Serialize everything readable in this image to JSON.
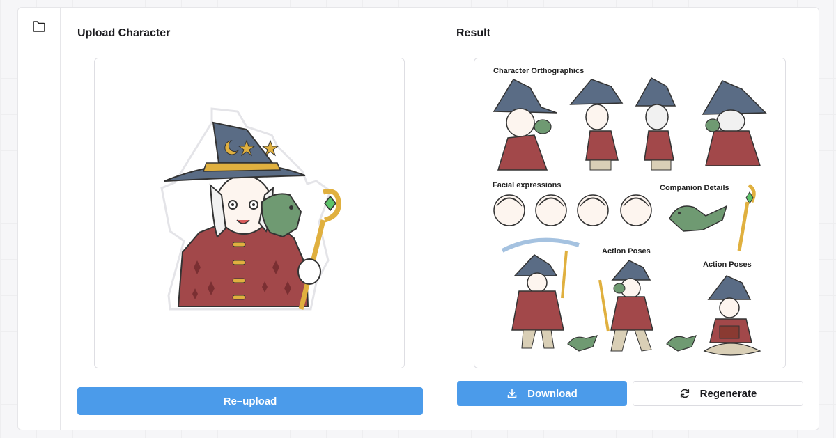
{
  "left_panel": {
    "title": "Upload Character",
    "reupload_label": "Re–upload"
  },
  "right_panel": {
    "title": "Result",
    "download_label": "Download",
    "regenerate_label": "Regenerate"
  },
  "sheet": {
    "orthographics_label": "Character Orthographics",
    "facial_label": "Facial expressions",
    "companion_label": "Companion Details",
    "action_label_1": "Action Poses",
    "action_label_2": "Action Poses"
  },
  "colors": {
    "accent": "#4b9bea",
    "hat": "#5a6c85",
    "cloak": "#a2484a",
    "dragon": "#6f9a72",
    "gold": "#e0b03f"
  },
  "icons": {
    "rail": "folder-icon",
    "download": "download-icon",
    "regenerate": "refresh-icon"
  }
}
